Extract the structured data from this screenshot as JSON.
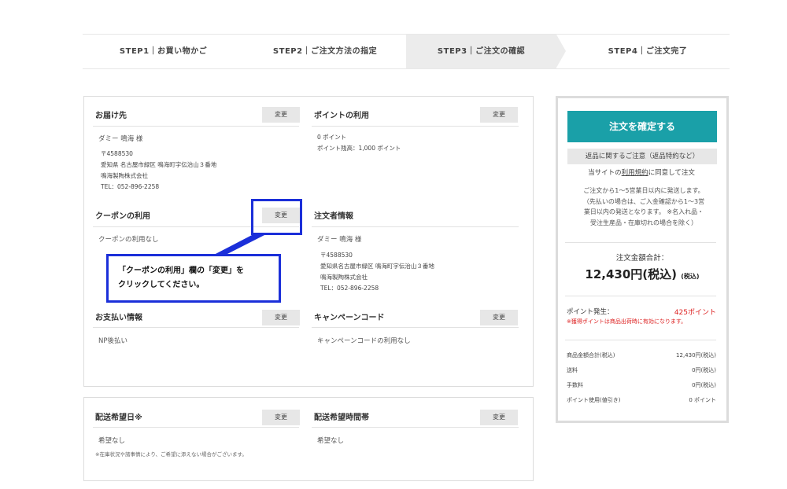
{
  "steps": [
    {
      "label": "STEP1｜お買い物かご"
    },
    {
      "label": "STEP2｜ご注文方法の指定"
    },
    {
      "label": "STEP3｜ご注文の確認"
    },
    {
      "label": "STEP4｜ご注文完了"
    }
  ],
  "change_label": "変更",
  "delivery": {
    "title": "お届け先",
    "name": "ダミー 鳴海 様",
    "postal": "〒4588530",
    "address": "愛知県 名古屋市緑区 鳴海町字伝治山３番地",
    "company": "鳴海製陶株式会社",
    "tel": "TEL：052-896-2258"
  },
  "points": {
    "title": "ポイントの利用",
    "used": "0 ポイント",
    "balance": "ポイント残高：1,000 ポイント"
  },
  "coupon": {
    "title": "クーポンの利用",
    "value": "クーポンの利用なし"
  },
  "orderer": {
    "title": "注文者情報",
    "name": "ダミー 鳴海 様",
    "postal": "〒4588530",
    "address": "愛知県名古屋市緑区 鳴海町字伝治山３番地",
    "company": "鳴海製陶株式会社",
    "tel": "TEL：052-896-2258"
  },
  "callout": {
    "line1": "「クーポンの利用」欄の「変更」を",
    "line2": "クリックしてください。"
  },
  "payment": {
    "title": "お支払い情報",
    "value": "NP後払い"
  },
  "campaign": {
    "title": "キャンペーンコード",
    "value": "キャンペーンコードの利用なし"
  },
  "delivery_date": {
    "title": "配送希望日※",
    "value": "希望なし",
    "note": "※在庫状況や諸事情により、ご希望に添えない場合がございます。"
  },
  "delivery_time": {
    "title": "配送希望時間帯",
    "value": "希望なし"
  },
  "summary": {
    "confirm_button": "注文を確定する",
    "notice_button": "返品に関するご注意（返品特約など）",
    "agree_pre": "当サイトの",
    "agree_link": "利用規約",
    "agree_post": "に同意して注文",
    "ship_note_1": "ご注文から1〜5営業日以内に発送します。",
    "ship_note_2": "（先払いの場合は、ご入金確認から1〜3営",
    "ship_note_3": "業日以内の発送となります。 ※名入れ品・",
    "ship_note_4": "受注生産品・在庫切れの場合を除く）",
    "total_label": "注文金額合計：",
    "total_value": "12,430円(税込)",
    "total_suffix": "(税込)",
    "total_amount": "12,430円",
    "points_label": "ポイント発生：",
    "points_value": "425ポイント",
    "points_note": "※獲得ポイントは商品出荷時に有効になります。",
    "rows": [
      {
        "label": "商品金額合計(税込)",
        "value": "12,430円(税込)"
      },
      {
        "label": "送料",
        "value": "0円(税込)"
      },
      {
        "label": "手数料",
        "value": "0円(税込)"
      },
      {
        "label": "ポイント使用(値引き)",
        "value": "0 ポイント"
      }
    ]
  }
}
